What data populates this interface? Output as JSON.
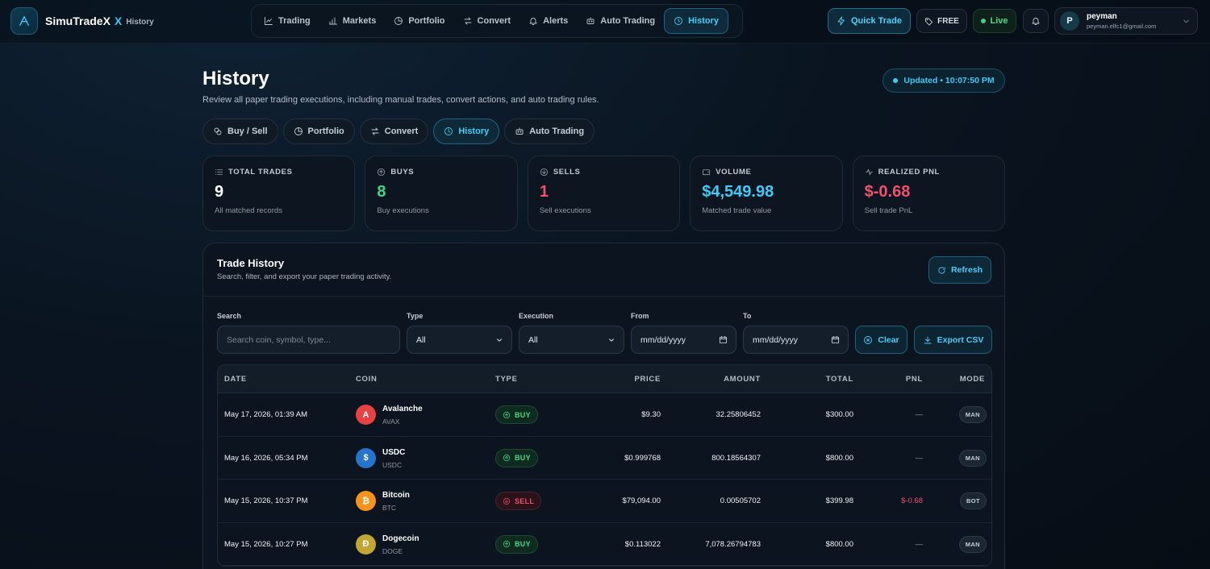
{
  "app": {
    "name": "SimuTradeX",
    "x": "X",
    "section": "History"
  },
  "nav": [
    {
      "label": "Trading",
      "icon": "chart-line-icon",
      "active": false
    },
    {
      "label": "Markets",
      "icon": "bar-chart-icon",
      "active": false
    },
    {
      "label": "Portfolio",
      "icon": "pie-chart-icon",
      "active": false
    },
    {
      "label": "Convert",
      "icon": "swap-icon",
      "active": false
    },
    {
      "label": "Alerts",
      "icon": "bell-icon",
      "active": false
    },
    {
      "label": "Auto Trading",
      "icon": "robot-icon",
      "active": false
    },
    {
      "label": "History",
      "icon": "clock-icon",
      "active": true
    }
  ],
  "header_actions": {
    "quick_trade": "Quick Trade",
    "plan": "FREE",
    "status": "Live"
  },
  "user": {
    "initial": "P",
    "name": "peyman",
    "email": "peyman.elfc1@gmail.com"
  },
  "page": {
    "title": "History",
    "subtitle": "Review all paper trading executions, including manual trades, convert actions, and auto trading rules.",
    "updated": "Updated • 10:07:50 PM"
  },
  "subtabs": [
    {
      "label": "Buy / Sell",
      "icon": "coins-icon",
      "active": false
    },
    {
      "label": "Portfolio",
      "icon": "pie-chart-icon",
      "active": false
    },
    {
      "label": "Convert",
      "icon": "swap-icon",
      "active": false
    },
    {
      "label": "History",
      "icon": "clock-icon",
      "active": true
    },
    {
      "label": "Auto Trading",
      "icon": "robot-icon",
      "active": false
    }
  ],
  "stats": [
    {
      "label": "TOTAL TRADES",
      "value": "9",
      "caption": "All matched records",
      "color": "#ffffff",
      "icon": "list-icon"
    },
    {
      "label": "BUYS",
      "value": "8",
      "caption": "Buy executions",
      "color": "#3fd98a",
      "icon": "arrow-up-circle-icon"
    },
    {
      "label": "SELLS",
      "value": "1",
      "caption": "Sell executions",
      "color": "#f2506b",
      "icon": "arrow-down-circle-icon"
    },
    {
      "label": "VOLUME",
      "value": "$4,549.98",
      "caption": "Matched trade value",
      "color": "#3fcbf5",
      "icon": "wallet-icon"
    },
    {
      "label": "REALIZED PNL",
      "value": "$-0.68",
      "caption": "Sell trade PnL",
      "color": "#f2506b",
      "icon": "activity-icon"
    }
  ],
  "panel": {
    "title": "Trade History",
    "subtitle": "Search, filter, and export your paper trading activity.",
    "refresh": "Refresh"
  },
  "filters": {
    "search_label": "Search",
    "search_placeholder": "Search coin, symbol, type...",
    "type_label": "Type",
    "type_value": "All",
    "execution_label": "Execution",
    "execution_value": "All",
    "from_label": "From",
    "from_value": "mm/dd/yyyy",
    "to_label": "To",
    "to_value": "mm/dd/yyyy",
    "clear": "Clear",
    "export": "Export CSV"
  },
  "table": {
    "columns": [
      "DATE",
      "COIN",
      "TYPE",
      "PRICE",
      "AMOUNT",
      "TOTAL",
      "PNL",
      "MODE"
    ],
    "rows": [
      {
        "date": "May 17, 2026, 01:39 AM",
        "coin": "Avalanche",
        "symbol": "AVAX",
        "coin_color": "#e84142",
        "coin_glyph": "A",
        "type": "BUY",
        "price": "$9.30",
        "amount": "32.25806452",
        "total": "$300.00",
        "pnl": "—",
        "mode": "MAN"
      },
      {
        "date": "May 16, 2026, 05:34 PM",
        "coin": "USDC",
        "symbol": "USDC",
        "coin_color": "#2775ca",
        "coin_glyph": "$",
        "type": "BUY",
        "price": "$0.999768",
        "amount": "800.18564307",
        "total": "$800.00",
        "pnl": "—",
        "mode": "MAN"
      },
      {
        "date": "May 15, 2026, 10:37 PM",
        "coin": "Bitcoin",
        "symbol": "BTC",
        "coin_color": "#f7931a",
        "coin_glyph": "₿",
        "type": "SELL",
        "price": "$79,094.00",
        "amount": "0.00505702",
        "total": "$399.98",
        "pnl": "$-0.68",
        "mode": "BOT"
      },
      {
        "date": "May 15, 2026, 10:27 PM",
        "coin": "Dogecoin",
        "symbol": "DOGE",
        "coin_color": "#c2a633",
        "coin_glyph": "Ð",
        "type": "BUY",
        "price": "$0.113022",
        "amount": "7,078.26794783",
        "total": "$800.00",
        "pnl": "—",
        "mode": "MAN"
      },
      {
        "date": "",
        "coin": "",
        "symbol": "",
        "coin_color": "#1b2632",
        "coin_glyph": "",
        "type": "",
        "price": "",
        "amount": "",
        "total": "",
        "pnl": "",
        "mode": ""
      }
    ]
  }
}
